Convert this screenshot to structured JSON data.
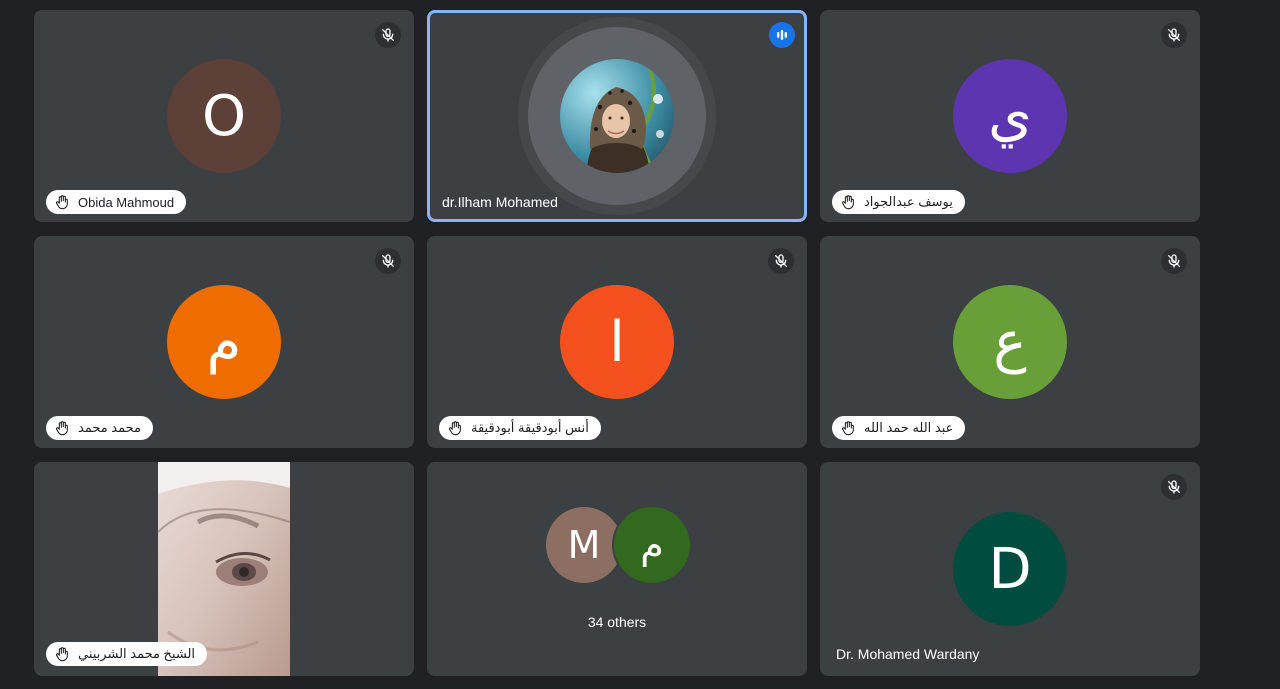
{
  "theme": {
    "background": "#202124",
    "tile": "#3c4043",
    "active_border": "#8ab4f8",
    "speaking": "#1a73e8"
  },
  "tiles": [
    {
      "name": "Obida Mahmoud",
      "initial": "O",
      "color": "#5d4037",
      "muted": true,
      "hand_raised": true
    },
    {
      "name": "dr.Ilham Mohamed",
      "muted": false,
      "speaking": true,
      "has_photo": true
    },
    {
      "name": "يوسف عبدالجواد",
      "initial": "ي",
      "color": "#5e35b1",
      "muted": true,
      "hand_raised": true
    },
    {
      "name": "محمد محمد",
      "initial": "م",
      "color": "#ef6c00",
      "muted": true,
      "hand_raised": true
    },
    {
      "name": "أنس أبودقيقة أبودقيقة",
      "initial": "ا",
      "color": "#f4511e",
      "muted": true,
      "hand_raised": true
    },
    {
      "name": "عبد الله حمد الله",
      "initial": "ع",
      "color": "#689f38",
      "muted": true,
      "hand_raised": true
    },
    {
      "name": "الشيخ محمد الشربيني",
      "muted": false,
      "hand_raised": true,
      "has_video": true
    },
    {
      "others_label": "34 others",
      "others": [
        {
          "initial": "M",
          "color": "#8d6e63"
        },
        {
          "initial": "م",
          "color": "#33691e"
        }
      ]
    },
    {
      "name": "Dr. Mohamed Wardany",
      "initial": "D",
      "color": "#004d40",
      "muted": true
    }
  ]
}
